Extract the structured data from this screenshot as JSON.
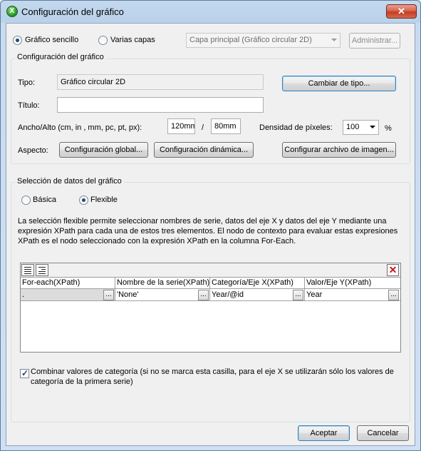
{
  "window": {
    "title": "Configuración del gráfico",
    "close_glyph": "✕",
    "app_icon_glyph": "X"
  },
  "mode": {
    "simple_label": "Gráfico sencillo",
    "layers_label": "Varias capas",
    "layer_select_value": "Capa principal (Gráfico circular 2D)",
    "manage_label": "Administrar..."
  },
  "config": {
    "group_title": "Configuración del gráfico",
    "type_label": "Tipo:",
    "type_value": "Gráfico circular 2D",
    "change_type_label": "Cambiar de tipo...",
    "title_label": "Título:",
    "title_value": "",
    "size_label": "Ancho/Alto  (cm, in , mm, pc, pt, px):",
    "width_value": "120mm",
    "separator": "/",
    "height_value": "80mm",
    "density_label": "Densidad de píxeles:",
    "density_value": "100",
    "density_unit": "%",
    "aspect_label": "Aspecto:",
    "global_config_label": "Configuración global...",
    "dynamic_config_label": "Configuración dinámica...",
    "image_file_label": "Configurar archivo de imagen..."
  },
  "selection": {
    "group_title": "Selección de datos del gráfico",
    "basic_label": "Básica",
    "flexible_label": "Flexible",
    "description_lines": [
      "La selección flexible permite seleccionar nombres de serie, datos del eje X y datos del eje Y mediante una",
      "expresión XPath para cada una de estos tres elementos. El nodo de contexto para evaluar estas expresiones",
      "XPath es el nodo seleccionado con la expresión XPath en la columna For-Each."
    ],
    "columns": [
      "For-each(XPath)",
      "Nombre de la serie(XPath)",
      "Categoría/Eje X(XPath)",
      "Valor/Eje Y(XPath)"
    ],
    "row": [
      ".",
      "'None'",
      "Year/@id",
      "Year"
    ],
    "ellipsis": "..."
  },
  "combine": {
    "checked": true,
    "check_glyph": "✓",
    "line1": "Combinar valores de categoría (si no se marca esta casilla, para el eje X se utilizarán sólo los valores de",
    "line2": "categoría de la primera serie)"
  },
  "footer": {
    "ok_label": "Aceptar",
    "cancel_label": "Cancelar"
  },
  "colors": {
    "accent": "#3c7fb1",
    "delete": "#c21a1a",
    "app_icon": "#2c9e2a"
  }
}
